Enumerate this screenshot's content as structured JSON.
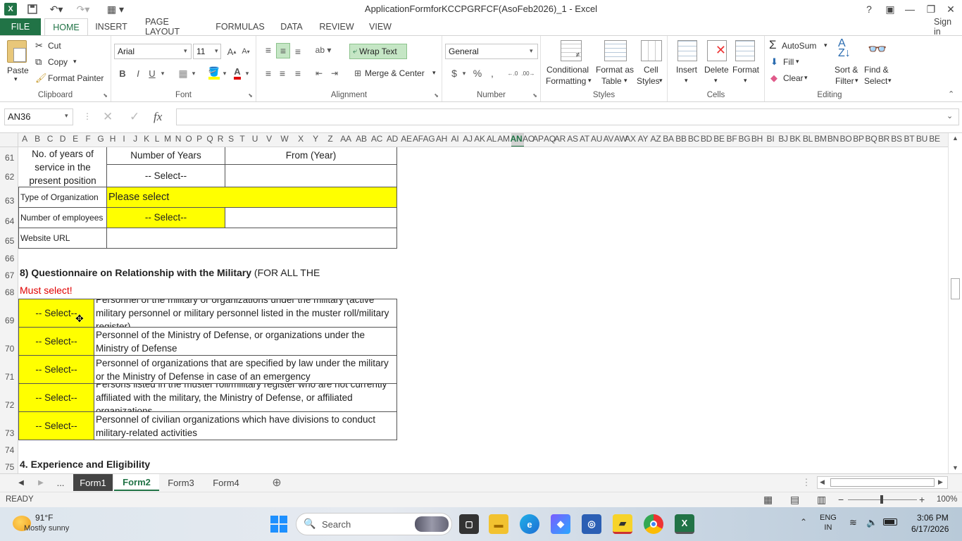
{
  "titlebar": {
    "title": "ApplicationFormforKCCPGRFCF(AsoFeb2026)_1 - Excel",
    "help": "?",
    "minimize": "—",
    "restore": "❐",
    "close": "✕"
  },
  "ribbon_tabs": [
    "FILE",
    "HOME",
    "INSERT",
    "PAGE LAYOUT",
    "FORMULAS",
    "DATA",
    "REVIEW",
    "VIEW"
  ],
  "signin": "Sign in",
  "ribbon": {
    "clipboard": {
      "paste": "Paste",
      "cut": "Cut",
      "copy": "Copy",
      "format_painter": "Format Painter",
      "label": "Clipboard"
    },
    "font": {
      "family": "Arial",
      "size": "11",
      "bold": "B",
      "italic": "I",
      "underline": "U",
      "label": "Font"
    },
    "alignment": {
      "wrap": "Wrap Text",
      "merge": "Merge & Center",
      "label": "Alignment"
    },
    "number": {
      "format": "General",
      "currency": "$",
      "percent": "%",
      "comma": ",",
      "label": "Number"
    },
    "styles": {
      "conditional": "Conditional",
      "conditional2": "Formatting",
      "format_as": "Format as",
      "table": "Table",
      "cell": "Cell",
      "styles": "Styles",
      "label": "Styles"
    },
    "cells": {
      "insert": "Insert",
      "delete": "Delete",
      "format": "Format",
      "label": "Cells"
    },
    "editing": {
      "autosum": "AutoSum",
      "fill": "Fill",
      "clear": "Clear",
      "sort": "Sort &",
      "filter": "Filter",
      "find": "Find &",
      "select": "Select",
      "label": "Editing"
    }
  },
  "formula_bar": {
    "name_box": "AN36",
    "fx": "fx",
    "value": ""
  },
  "columns": [
    "A",
    "B",
    "C",
    "D",
    "E",
    "F",
    "G",
    "H",
    "I",
    "J",
    "K",
    "L",
    "M",
    "N",
    "O",
    "P",
    "Q",
    "R",
    "S",
    "T",
    "U",
    "V",
    "W",
    "X",
    "Y",
    "Z",
    "AA",
    "AB",
    "AC",
    "AD",
    "AE",
    "AF",
    "AG",
    "AH",
    "AI",
    "AJ",
    "AK",
    "AL",
    "AM",
    "AN",
    "AO",
    "AP",
    "AQ",
    "AR",
    "AS",
    "AT",
    "AU",
    "AV",
    "AW",
    "AX",
    "AY",
    "AZ",
    "BA",
    "BB",
    "BC",
    "BD",
    "BE",
    "BF",
    "BG",
    "BH",
    "BI",
    "BJ",
    "BK",
    "BL",
    "BM",
    "BN",
    "BO",
    "BP",
    "BQ",
    "BR",
    "BS",
    "BT",
    "BU",
    "BE"
  ],
  "rows": [
    "61",
    "62",
    "63",
    "64",
    "65",
    "66",
    "67",
    "68",
    "69",
    "70",
    "71",
    "72",
    "73",
    "74",
    "75"
  ],
  "sheet": {
    "years_label": "No. of years of service in the present position",
    "num_years_hdr": "Number of Years",
    "from_year_hdr": "From (Year)",
    "years_select": "-- Select--",
    "org_type_label": "Type of Organization",
    "org_type_value": "Please select",
    "employees_label": "Number of employees",
    "employees_select": "-- Select--",
    "website_label": "Website URL",
    "section8_bold": "8) Questionnaire on Relationship with the Military",
    "section8_rest": " (FOR ALL THE",
    "must_select": "Must select!",
    "q_rows": [
      {
        "select": "-- Select--",
        "text": "Personnel of the military or organizations under the military (active military personnel or military personnel listed in the muster roll/military register)"
      },
      {
        "select": "-- Select--",
        "text": "Personnel of the Ministry of Defense, or organizations under the Ministry of Defense"
      },
      {
        "select": "-- Select--",
        "text": "Personnel of organizations that are specified by law under the military or the Ministry of Defense in case of an emergency"
      },
      {
        "select": "-- Select--",
        "text": "Persons listed in the muster roll/military register who are not currently affiliated with the military, the Ministry of Defense, or affiliated organizations"
      },
      {
        "select": "-- Select--",
        "text": "Personnel of civilian organizations which have divisions to conduct military-related activities"
      }
    ],
    "section4": "4. Experience and Eligibility"
  },
  "sheet_tabs": [
    "Form1",
    "Form2",
    "Form3",
    "Form4"
  ],
  "sheet_ellipsis": "...",
  "status": {
    "ready": "READY",
    "zoom": "100%"
  },
  "taskbar": {
    "weather_temp": "91°F",
    "weather_desc": "Mostly sunny",
    "search": "Search",
    "lang1": "ENG",
    "lang2": "IN",
    "time": "3:06 PM",
    "date": "6/17/2026"
  },
  "colors": {
    "excel_green": "#217346",
    "highlight_yellow": "#ffff00",
    "must_red": "#e00000"
  }
}
